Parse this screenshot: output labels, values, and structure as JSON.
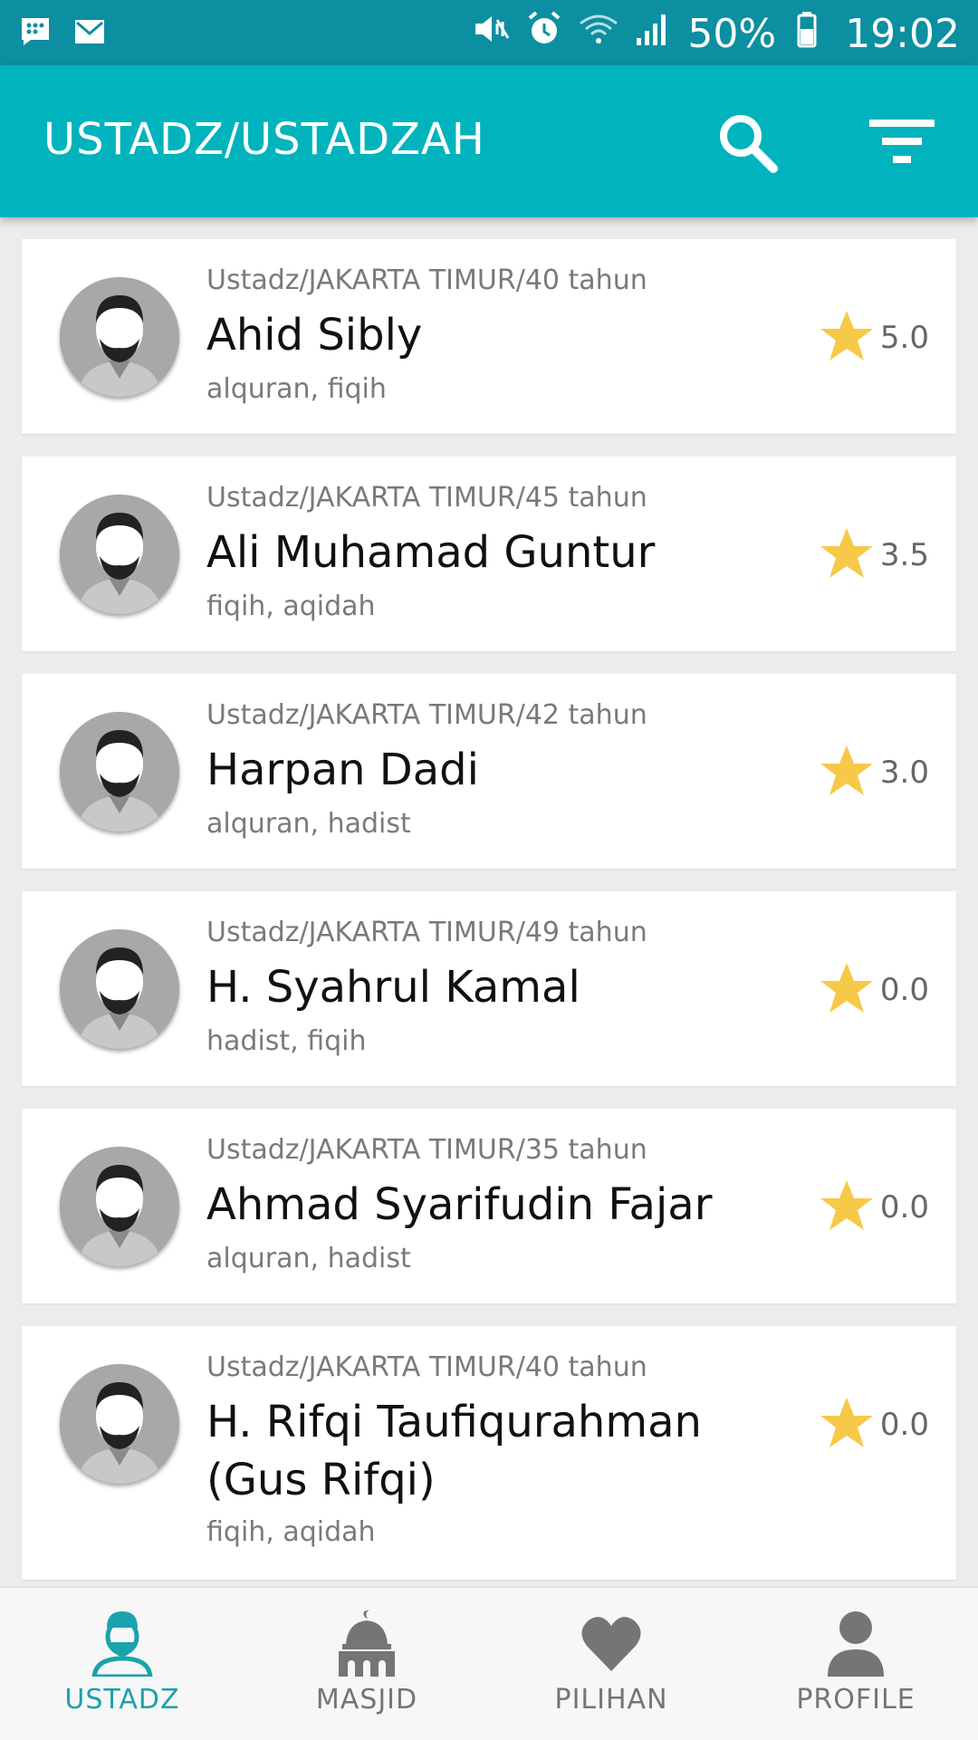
{
  "status_bar": {
    "battery": "50%",
    "time": "19:02",
    "left_icons": [
      "bbm-icon",
      "gmail-icon"
    ],
    "right_icons": [
      "mute-vibrate-icon",
      "alarm-icon",
      "wifi-icon",
      "signal-icon",
      "battery-icon"
    ]
  },
  "app_bar": {
    "title": "USTADZ/USTADZAH",
    "search_icon": "search-icon",
    "filter_icon": "filter-icon",
    "color": "#00b3bd"
  },
  "list": {
    "items": [
      {
        "meta": "Ustadz/JAKARTA TIMUR/40 tahun",
        "name": "Ahid Sibly",
        "topics": "alquran, fiqih",
        "rating": "5.0"
      },
      {
        "meta": "Ustadz/JAKARTA TIMUR/45 tahun",
        "name": "Ali Muhamad Guntur",
        "topics": "fiqih, aqidah",
        "rating": "3.5"
      },
      {
        "meta": "Ustadz/JAKARTA TIMUR/42 tahun",
        "name": "Harpan Dadi",
        "topics": "alquran, hadist",
        "rating": "3.0"
      },
      {
        "meta": "Ustadz/JAKARTA TIMUR/49 tahun",
        "name": "H. Syahrul Kamal",
        "topics": "hadist, fiqih",
        "rating": "0.0"
      },
      {
        "meta": "Ustadz/JAKARTA TIMUR/35 tahun",
        "name": "Ahmad Syarifudin Fajar",
        "topics": "alquran, hadist",
        "rating": "0.0"
      },
      {
        "meta": "Ustadz/JAKARTA TIMUR/40 tahun",
        "name": "H. Rifqi Taufiqurahman (Gus Rifqi)",
        "topics": "fiqih, aqidah",
        "rating": "0.0"
      }
    ],
    "star_color": "#f7c948"
  },
  "bottom_nav": {
    "items": [
      {
        "label": "USTADZ",
        "icon": "ustadz-icon",
        "active": true
      },
      {
        "label": "MASJID",
        "icon": "mosque-icon",
        "active": false
      },
      {
        "label": "PILIHAN",
        "icon": "heart-icon",
        "active": false
      },
      {
        "label": "PROFILE",
        "icon": "person-icon",
        "active": false
      }
    ],
    "active_color": "#1aa2ad",
    "inactive_color": "#757575"
  }
}
